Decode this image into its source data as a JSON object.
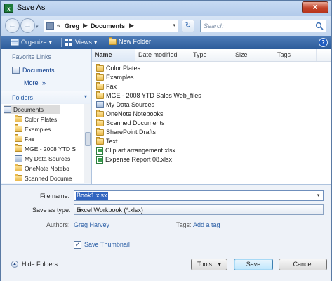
{
  "window": {
    "title": "Save As",
    "app_icon": "excel-app-icon",
    "close_glyph": "x"
  },
  "navigation": {
    "back_glyph": "←",
    "forward_glyph": "→",
    "address": {
      "prefix": "«",
      "segments": [
        "Greg",
        "Documents"
      ],
      "separator": "▶",
      "dropdown_glyph": "▾"
    },
    "refresh_glyph": "↻",
    "search_placeholder": "Search"
  },
  "toolbar": {
    "organize_label": "Organize",
    "views_label": "Views",
    "new_folder_label": "New Folder",
    "dropdown_glyph": "▾",
    "help_glyph": "?"
  },
  "left_pane": {
    "favorite_links_label": "Favorite Links",
    "favorites": [
      "Documents"
    ],
    "more_label": "More",
    "more_glyph": "»",
    "folders_label": "Folders",
    "folders_glyph": "▾",
    "tree": [
      {
        "label": "Documents",
        "icon": "documents-icon",
        "selected": true
      },
      {
        "label": "Color Plates",
        "icon": "folder-icon"
      },
      {
        "label": "Examples",
        "icon": "folder-icon"
      },
      {
        "label": "Fax",
        "icon": "folder-icon"
      },
      {
        "label": "MGE - 2008 YTD S",
        "icon": "folder-icon"
      },
      {
        "label": "My Data Sources",
        "icon": "data-sources-icon"
      },
      {
        "label": "OneNote Notebo",
        "icon": "folder-icon"
      },
      {
        "label": "Scanned Docume",
        "icon": "folder-icon"
      }
    ]
  },
  "file_list": {
    "columns": [
      "Name",
      "Date modified",
      "Type",
      "Size",
      "Tags"
    ],
    "items": [
      {
        "name": "Color Plates",
        "icon": "folder-icon"
      },
      {
        "name": "Examples",
        "icon": "folder-icon"
      },
      {
        "name": "Fax",
        "icon": "folder-icon"
      },
      {
        "name": "MGE - 2008 YTD Sales Web_files",
        "icon": "folder-icon"
      },
      {
        "name": "My Data Sources",
        "icon": "data-sources-icon"
      },
      {
        "name": "OneNote Notebooks",
        "icon": "folder-icon"
      },
      {
        "name": "Scanned Documents",
        "icon": "folder-icon"
      },
      {
        "name": "SharePoint Drafts",
        "icon": "folder-icon"
      },
      {
        "name": "Text",
        "icon": "folder-icon"
      },
      {
        "name": "Clip art arrangement.xlsx",
        "icon": "xlsx-file-icon"
      },
      {
        "name": "Expense Report 08.xlsx",
        "icon": "xlsx-file-icon"
      }
    ]
  },
  "form": {
    "file_name_label": "File name:",
    "file_name_value": "Book1.xlsx",
    "save_as_type_label": "Save as type:",
    "save_as_type_value": "Excel Workbook (*.xlsx)",
    "authors_label": "Authors:",
    "authors_value": "Greg Harvey",
    "tags_label": "Tags:",
    "tags_value": "Add a tag",
    "save_thumbnail_label": "Save Thumbnail",
    "save_thumbnail_checked": true
  },
  "footer": {
    "hide_folders_label": "Hide Folders",
    "tools_label": "Tools",
    "tools_glyph": "▾",
    "save_label": "Save",
    "cancel_label": "Cancel"
  },
  "colors": {
    "accent": "#2d5c9a",
    "selection": "#3165c0",
    "link": "#2a5ea5"
  }
}
